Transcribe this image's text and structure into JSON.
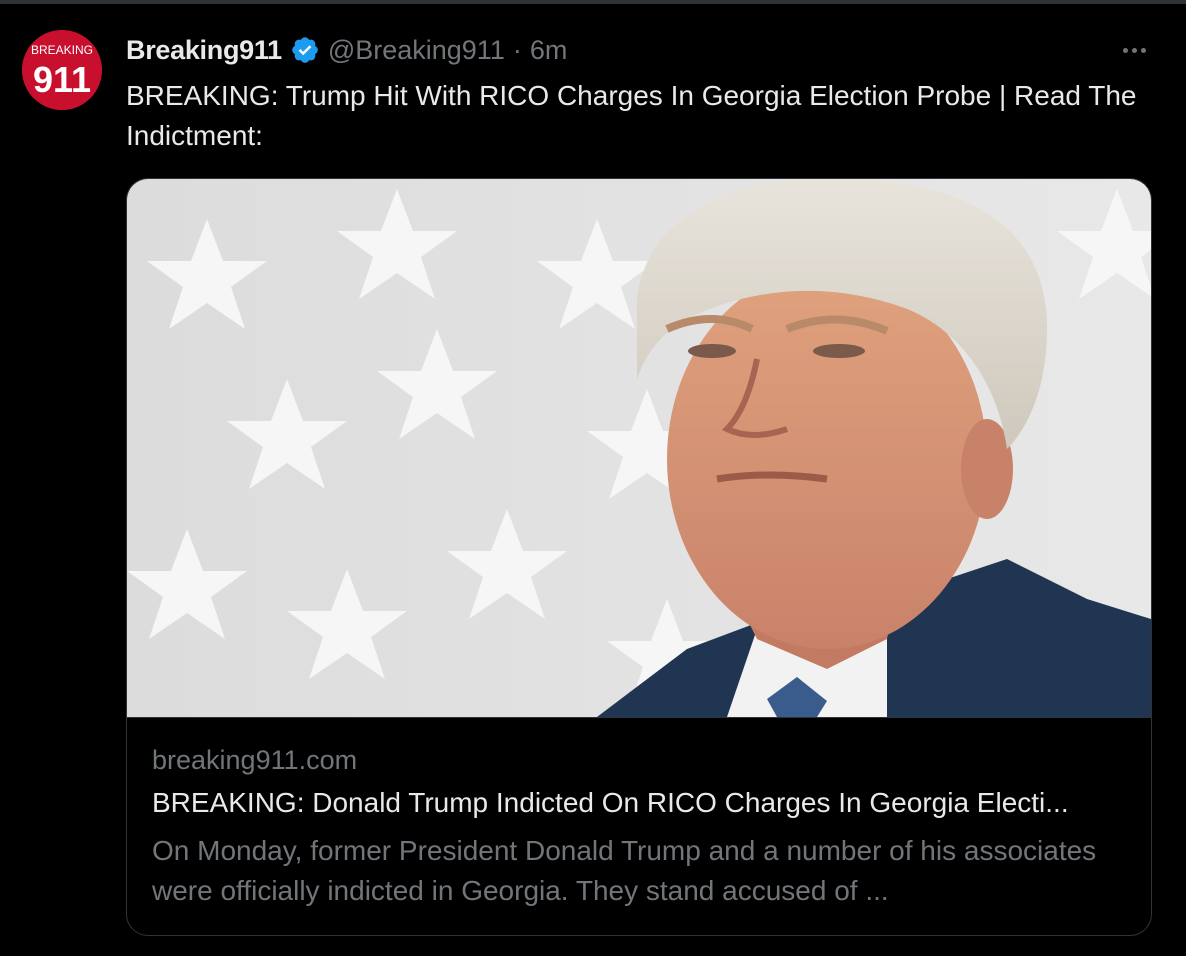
{
  "tweet": {
    "display_name": "Breaking911",
    "handle": "@Breaking911",
    "separator": "·",
    "time": "6m",
    "text": "BREAKING: Trump Hit With RICO Charges In Georgia Election Probe | Read The Indictment:",
    "avatar_text_top": "BREAKING",
    "avatar_text_main": "911",
    "verified_icon": "verified-badge-icon",
    "more_icon": "more-horizontal-icon"
  },
  "card": {
    "domain": "breaking911.com",
    "title": "BREAKING: Donald Trump Indicted On RICO Charges In Georgia Electi...",
    "description": "On Monday, former President Donald Trump and a number of his associates were officially indicted in Georgia. They stand accused of ...",
    "image": "portrait photo in front of star background"
  },
  "colors": {
    "background": "#000000",
    "text_primary": "#e7e9ea",
    "text_secondary": "#71767b",
    "border": "#2f3336",
    "verified": "#1d9bf0",
    "avatar_red": "#c8102e"
  }
}
